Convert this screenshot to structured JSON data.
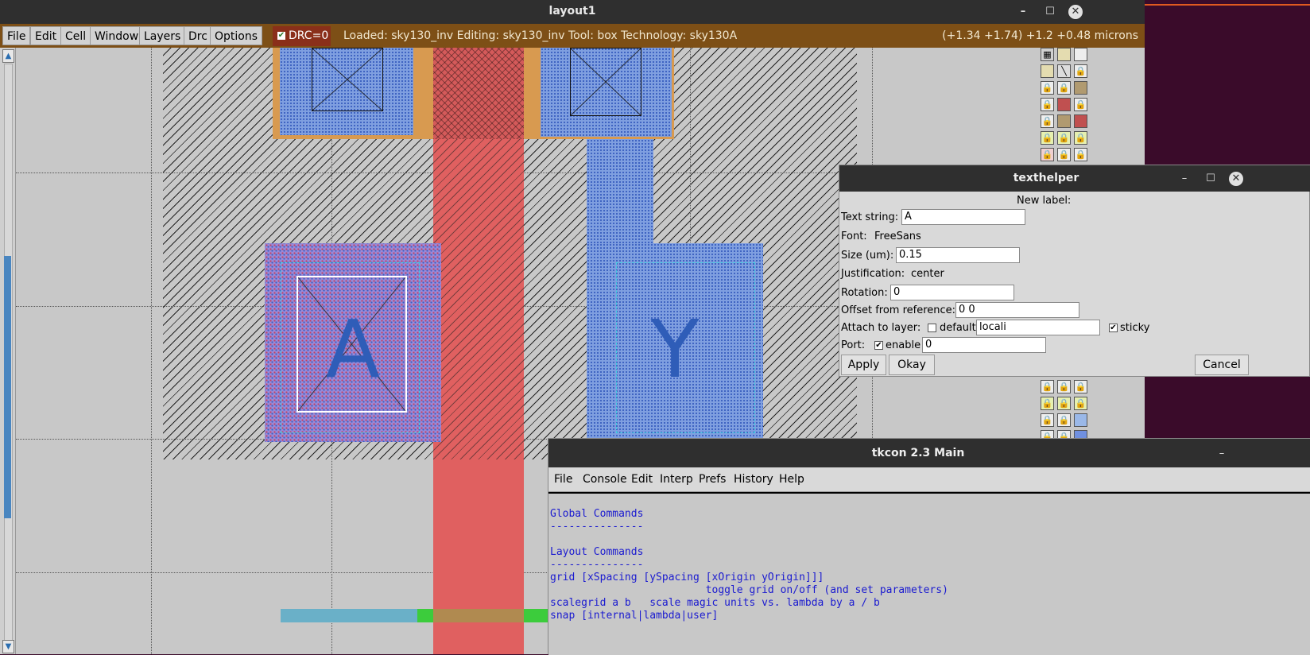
{
  "main_window": {
    "title": "layout1",
    "menu": [
      "File",
      "Edit",
      "Cell",
      "Window",
      "Layers",
      "Drc",
      "Options"
    ],
    "drc_label": "DRC=0",
    "status": "Loaded: sky130_inv Editing: sky130_inv Tool: box  Technology: sky130A",
    "coords": "(+1.34 +1.74) +1.2 +0.48 microns",
    "labels": {
      "a": "A",
      "y": "Y"
    }
  },
  "window_controls": {
    "minimize": "–",
    "maximize": "☐",
    "close": "✕"
  },
  "texthelper": {
    "title": "texthelper",
    "heading": "New label:",
    "text_string_label": "Text string:",
    "text_string_value": "A",
    "font_label": "Font:",
    "font_value": "FreeSans",
    "size_label": "Size (um):",
    "size_value": "0.15",
    "justification_label": "Justification:",
    "justification_value": "center",
    "rotation_label": "Rotation:",
    "rotation_value": "0",
    "offset_label": "Offset from reference:",
    "offset_value": "0 0",
    "attach_label": "Attach to layer:",
    "default_label": "default",
    "layer_value": "locali",
    "sticky_label": "sticky",
    "port_label": "Port:",
    "enable_label": "enable",
    "port_value": "0",
    "apply": "Apply",
    "okay": "Okay",
    "cancel": "Cancel"
  },
  "tkcon": {
    "title": "tkcon 2.3 Main",
    "menu": [
      "File",
      "Console",
      "Edit",
      "Interp",
      "Prefs",
      "History",
      "Help"
    ],
    "lines": [
      "Global Commands",
      "---------------",
      "",
      "Layout Commands",
      "---------------",
      "grid [xSpacing [ySpacing [xOrigin yOrigin]]]",
      "                         toggle grid on/off (and set parameters)",
      "scalegrid a b   scale magic units vs. lambda by a / b",
      "snap [internal|lambda|user]"
    ]
  },
  "colors": {
    "menubar": "#7d4f16",
    "poly": "#e06060",
    "locali": "#7f9fe0",
    "console_text": "#1a1ad0"
  }
}
